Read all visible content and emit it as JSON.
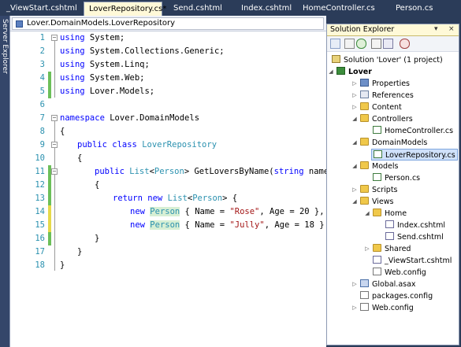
{
  "tabs": [
    {
      "label": "_ViewStart.cshtml",
      "active": false
    },
    {
      "label": "LoverRepository.cs*",
      "active": true
    },
    {
      "label": "Send.cshtml",
      "active": false
    },
    {
      "label": "Index.cshtml",
      "active": false
    },
    {
      "label": "HomeController.cs",
      "active": false
    },
    {
      "label": "Person.cs",
      "active": false
    }
  ],
  "side_panel": {
    "label": "Server Explorer"
  },
  "editor": {
    "member_dropdown": "Lover.DomainModels.LoverRepository",
    "line_numbers": [
      "1",
      "2",
      "3",
      "4",
      "5",
      "6",
      "7",
      "8",
      "9",
      "10",
      "11",
      "12",
      "13",
      "14",
      "15",
      "16",
      "17",
      "18"
    ]
  },
  "solution_explorer": {
    "title": "Solution Explorer",
    "title_controls": [
      "▾",
      "×"
    ],
    "toolbar_icons": [
      "properties-icon",
      "show-all-files-icon",
      "refresh-icon",
      "view-code-icon",
      "view-designer-icon",
      "class-diagram-icon"
    ],
    "items": [
      {
        "label": "Solution 'Lover' (1 project)",
        "icon": "solution-icon"
      },
      {
        "label": "Lover",
        "icon": "project-icon"
      },
      {
        "label": "Properties",
        "icon": "properties-folder-icon"
      },
      {
        "label": "References",
        "icon": "references-icon"
      },
      {
        "label": "Content",
        "icon": "folder-icon"
      },
      {
        "label": "Controllers",
        "icon": "folder-icon"
      },
      {
        "label": "HomeController.cs",
        "icon": "csharp-file-icon"
      },
      {
        "label": "DomainModels",
        "icon": "folder-icon"
      },
      {
        "label": "LoverRepository.cs",
        "icon": "csharp-file-icon"
      },
      {
        "label": "Models",
        "icon": "folder-icon"
      },
      {
        "label": "Person.cs",
        "icon": "csharp-file-icon"
      },
      {
        "label": "Scripts",
        "icon": "folder-icon"
      },
      {
        "label": "Views",
        "icon": "folder-icon"
      },
      {
        "label": "Home",
        "icon": "folder-icon"
      },
      {
        "label": "Index.cshtml",
        "icon": "cshtml-file-icon"
      },
      {
        "label": "Send.cshtml",
        "icon": "cshtml-file-icon"
      },
      {
        "label": "Shared",
        "icon": "folder-icon"
      },
      {
        "label": "_ViewStart.cshtml",
        "icon": "cshtml-file-icon"
      },
      {
        "label": "Web.config",
        "icon": "config-file-icon"
      },
      {
        "label": "Global.asax",
        "icon": "global-asax-icon"
      },
      {
        "label": "packages.config",
        "icon": "config-file-icon"
      },
      {
        "label": "Web.config",
        "icon": "config-file-icon"
      }
    ]
  },
  "code_tokens": {
    "l1_kw": "using",
    "l1_rest": " System;",
    "l2_kw": "using",
    "l2_rest": " System.Collections.Generic;",
    "l3_kw": "using",
    "l3_rest": " System.Linq;",
    "l4_kw": "using",
    "l4_rest": " System.Web;",
    "l5_kw": "using",
    "l5_rest": " Lover.Models;",
    "l7_kw": "namespace",
    "l7_rest": " Lover.DomainModels",
    "l8": "{",
    "l9_kw1": "public",
    "l9_kw2": "class",
    "l9_ty": "LoverRepository",
    "l10": "{",
    "l11_kw": "public",
    "l11_ty1": "List",
    "l11_lt": "<",
    "l11_ty2": "Person",
    "l11_gt": ">",
    "l11_rest": " GetLoversByName(",
    "l11_kw2": "string",
    "l11_end": " name)",
    "l12": "{",
    "l13_kw1": "return",
    "l13_kw2": "new",
    "l13_ty1": "List",
    "l13_lt": "<",
    "l13_ty2": "Person",
    "l13_end": "> {",
    "l14_kw": "new",
    "l14_ty": "Person",
    "l14_a": " { Name = ",
    "l14_s": "\"Rose\"",
    "l14_b": ", Age = 20 },",
    "l15_kw": "new",
    "l15_ty": "Person",
    "l15_a": " { Name = ",
    "l15_s": "\"Jully\"",
    "l15_b": ", Age = 18 } };",
    "l16": "}",
    "l17": "}"
  },
  "colors": {
    "keyword": "#0000ff",
    "type": "#2b91af",
    "string": "#a31515",
    "line_number": "#2b91af",
    "saved_change": "#6cbf59",
    "unsaved_change": "#e6d94a",
    "chrome": "#2b3c59"
  }
}
